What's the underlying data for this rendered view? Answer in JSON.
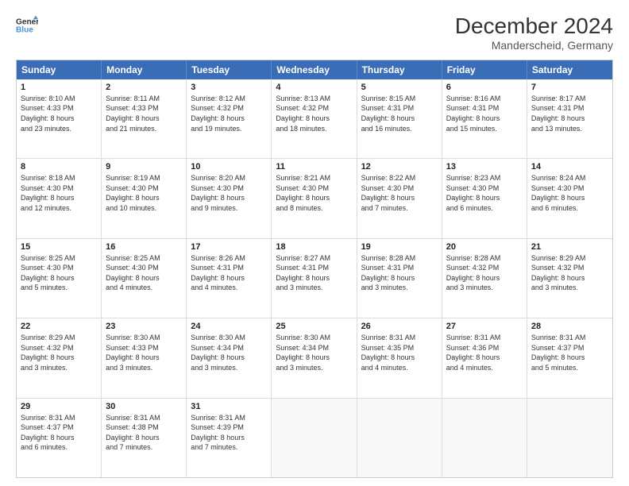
{
  "logo": {
    "line1": "General",
    "line2": "Blue"
  },
  "title": "December 2024",
  "location": "Manderscheid, Germany",
  "days_of_week": [
    "Sunday",
    "Monday",
    "Tuesday",
    "Wednesday",
    "Thursday",
    "Friday",
    "Saturday"
  ],
  "weeks": [
    [
      {
        "day": "1",
        "text": "Sunrise: 8:10 AM\nSunset: 4:33 PM\nDaylight: 8 hours\nand 23 minutes."
      },
      {
        "day": "2",
        "text": "Sunrise: 8:11 AM\nSunset: 4:33 PM\nDaylight: 8 hours\nand 21 minutes."
      },
      {
        "day": "3",
        "text": "Sunrise: 8:12 AM\nSunset: 4:32 PM\nDaylight: 8 hours\nand 19 minutes."
      },
      {
        "day": "4",
        "text": "Sunrise: 8:13 AM\nSunset: 4:32 PM\nDaylight: 8 hours\nand 18 minutes."
      },
      {
        "day": "5",
        "text": "Sunrise: 8:15 AM\nSunset: 4:31 PM\nDaylight: 8 hours\nand 16 minutes."
      },
      {
        "day": "6",
        "text": "Sunrise: 8:16 AM\nSunset: 4:31 PM\nDaylight: 8 hours\nand 15 minutes."
      },
      {
        "day": "7",
        "text": "Sunrise: 8:17 AM\nSunset: 4:31 PM\nDaylight: 8 hours\nand 13 minutes."
      }
    ],
    [
      {
        "day": "8",
        "text": "Sunrise: 8:18 AM\nSunset: 4:30 PM\nDaylight: 8 hours\nand 12 minutes."
      },
      {
        "day": "9",
        "text": "Sunrise: 8:19 AM\nSunset: 4:30 PM\nDaylight: 8 hours\nand 10 minutes."
      },
      {
        "day": "10",
        "text": "Sunrise: 8:20 AM\nSunset: 4:30 PM\nDaylight: 8 hours\nand 9 minutes."
      },
      {
        "day": "11",
        "text": "Sunrise: 8:21 AM\nSunset: 4:30 PM\nDaylight: 8 hours\nand 8 minutes."
      },
      {
        "day": "12",
        "text": "Sunrise: 8:22 AM\nSunset: 4:30 PM\nDaylight: 8 hours\nand 7 minutes."
      },
      {
        "day": "13",
        "text": "Sunrise: 8:23 AM\nSunset: 4:30 PM\nDaylight: 8 hours\nand 6 minutes."
      },
      {
        "day": "14",
        "text": "Sunrise: 8:24 AM\nSunset: 4:30 PM\nDaylight: 8 hours\nand 6 minutes."
      }
    ],
    [
      {
        "day": "15",
        "text": "Sunrise: 8:25 AM\nSunset: 4:30 PM\nDaylight: 8 hours\nand 5 minutes."
      },
      {
        "day": "16",
        "text": "Sunrise: 8:25 AM\nSunset: 4:30 PM\nDaylight: 8 hours\nand 4 minutes."
      },
      {
        "day": "17",
        "text": "Sunrise: 8:26 AM\nSunset: 4:31 PM\nDaylight: 8 hours\nand 4 minutes."
      },
      {
        "day": "18",
        "text": "Sunrise: 8:27 AM\nSunset: 4:31 PM\nDaylight: 8 hours\nand 3 minutes."
      },
      {
        "day": "19",
        "text": "Sunrise: 8:28 AM\nSunset: 4:31 PM\nDaylight: 8 hours\nand 3 minutes."
      },
      {
        "day": "20",
        "text": "Sunrise: 8:28 AM\nSunset: 4:32 PM\nDaylight: 8 hours\nand 3 minutes."
      },
      {
        "day": "21",
        "text": "Sunrise: 8:29 AM\nSunset: 4:32 PM\nDaylight: 8 hours\nand 3 minutes."
      }
    ],
    [
      {
        "day": "22",
        "text": "Sunrise: 8:29 AM\nSunset: 4:32 PM\nDaylight: 8 hours\nand 3 minutes."
      },
      {
        "day": "23",
        "text": "Sunrise: 8:30 AM\nSunset: 4:33 PM\nDaylight: 8 hours\nand 3 minutes."
      },
      {
        "day": "24",
        "text": "Sunrise: 8:30 AM\nSunset: 4:34 PM\nDaylight: 8 hours\nand 3 minutes."
      },
      {
        "day": "25",
        "text": "Sunrise: 8:30 AM\nSunset: 4:34 PM\nDaylight: 8 hours\nand 3 minutes."
      },
      {
        "day": "26",
        "text": "Sunrise: 8:31 AM\nSunset: 4:35 PM\nDaylight: 8 hours\nand 4 minutes."
      },
      {
        "day": "27",
        "text": "Sunrise: 8:31 AM\nSunset: 4:36 PM\nDaylight: 8 hours\nand 4 minutes."
      },
      {
        "day": "28",
        "text": "Sunrise: 8:31 AM\nSunset: 4:37 PM\nDaylight: 8 hours\nand 5 minutes."
      }
    ],
    [
      {
        "day": "29",
        "text": "Sunrise: 8:31 AM\nSunset: 4:37 PM\nDaylight: 8 hours\nand 6 minutes."
      },
      {
        "day": "30",
        "text": "Sunrise: 8:31 AM\nSunset: 4:38 PM\nDaylight: 8 hours\nand 7 minutes."
      },
      {
        "day": "31",
        "text": "Sunrise: 8:31 AM\nSunset: 4:39 PM\nDaylight: 8 hours\nand 7 minutes."
      },
      {
        "day": "",
        "text": ""
      },
      {
        "day": "",
        "text": ""
      },
      {
        "day": "",
        "text": ""
      },
      {
        "day": "",
        "text": ""
      }
    ]
  ]
}
